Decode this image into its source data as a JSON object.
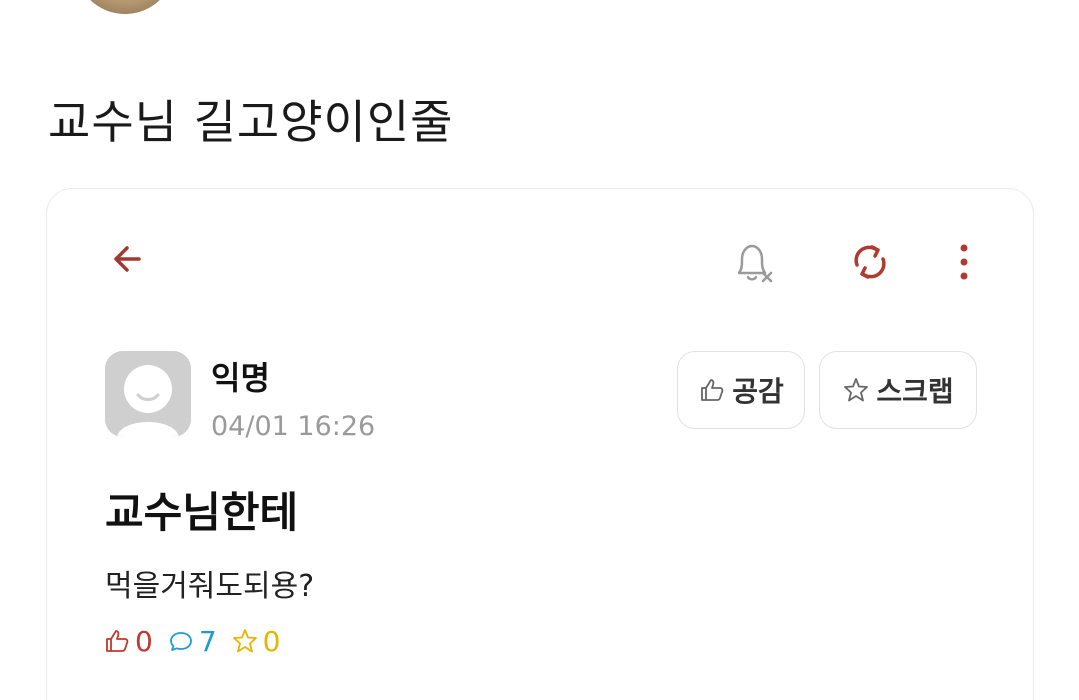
{
  "post": {
    "caption": "교수님 길고양이인줄"
  },
  "screenshot": {
    "icons": {
      "back": "arrow-left-icon",
      "notification": "bell-off-icon",
      "refresh": "refresh-icon",
      "more": "more-vertical-icon"
    },
    "author": {
      "name": "익명",
      "date": "04/01 16:26"
    },
    "actions": {
      "like_label": "공감",
      "scrap_label": "스크랩"
    },
    "article": {
      "title": "교수님한테",
      "body": "먹을거줘도되용?"
    },
    "stats": {
      "likes": "0",
      "comments": "7",
      "scraps": "0"
    },
    "colors": {
      "accent": "#c0392b",
      "comment": "#1e9bd7",
      "scrap": "#e8b400"
    }
  }
}
